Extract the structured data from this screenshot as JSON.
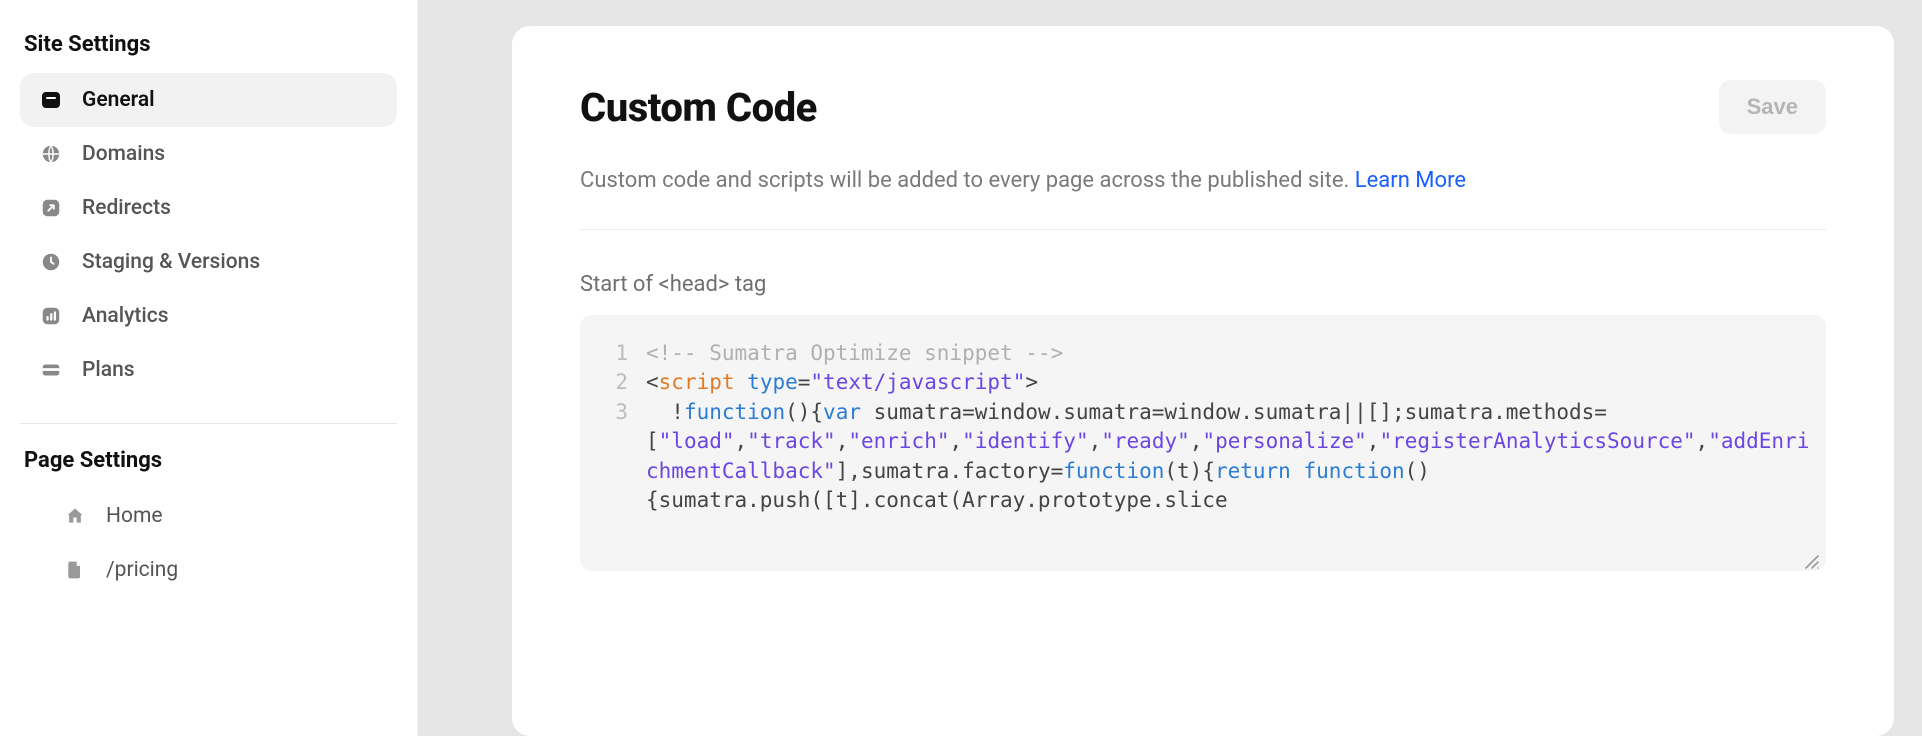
{
  "sidebar": {
    "site_settings_heading": "Site Settings",
    "items": [
      {
        "label": "General",
        "icon": "general"
      },
      {
        "label": "Domains",
        "icon": "globe"
      },
      {
        "label": "Redirects",
        "icon": "redirect"
      },
      {
        "label": "Staging & Versions",
        "icon": "clock"
      },
      {
        "label": "Analytics",
        "icon": "analytics"
      },
      {
        "label": "Plans",
        "icon": "card"
      }
    ],
    "page_settings_heading": "Page Settings",
    "pages": [
      {
        "label": "Home",
        "icon": "home"
      },
      {
        "label": "/pricing",
        "icon": "file"
      }
    ]
  },
  "main": {
    "title": "Custom Code",
    "save_label": "Save",
    "description_text": "Custom code and scripts will be added to every page across the published site. ",
    "learn_more_label": "Learn More",
    "field_label": "Start of <head> tag",
    "code_tokens": [
      [
        {
          "t": "<!-- Sumatra Optimize snippet -->",
          "c": "comment"
        }
      ],
      [
        {
          "t": "<",
          "c": "punct"
        },
        {
          "t": "script",
          "c": "tag"
        },
        {
          "t": " ",
          "c": "punct"
        },
        {
          "t": "type",
          "c": "attr"
        },
        {
          "t": "=",
          "c": "punct"
        },
        {
          "t": "\"text/javascript\"",
          "c": "string"
        },
        {
          "t": ">",
          "c": "punct"
        }
      ],
      [
        {
          "t": "  !",
          "c": "punct"
        },
        {
          "t": "function",
          "c": "keyword"
        },
        {
          "t": "(){",
          "c": "punct"
        },
        {
          "t": "var",
          "c": "keyword"
        },
        {
          "t": " sumatra=window.sumatra=window.sumatra||[];sumatra.methods=[",
          "c": "punct"
        },
        {
          "t": "\"load\"",
          "c": "string"
        },
        {
          "t": ",",
          "c": "punct"
        },
        {
          "t": "\"track\"",
          "c": "string"
        },
        {
          "t": ",",
          "c": "punct"
        },
        {
          "t": "\"enrich\"",
          "c": "string"
        },
        {
          "t": ",",
          "c": "punct"
        },
        {
          "t": "\"identify\"",
          "c": "string"
        },
        {
          "t": ",",
          "c": "punct"
        },
        {
          "t": "\"ready\"",
          "c": "string"
        },
        {
          "t": ",",
          "c": "punct"
        },
        {
          "t": "\"personalize\"",
          "c": "string"
        },
        {
          "t": ",",
          "c": "punct"
        },
        {
          "t": "\"registerAnalyticsSource\"",
          "c": "string"
        },
        {
          "t": ",",
          "c": "punct"
        },
        {
          "t": "\"addEnrichmentCallback\"",
          "c": "string"
        },
        {
          "t": "],sumatra.factory=",
          "c": "punct"
        },
        {
          "t": "function",
          "c": "keyword"
        },
        {
          "t": "(t){",
          "c": "punct"
        },
        {
          "t": "return",
          "c": "keyword"
        },
        {
          "t": " ",
          "c": "punct"
        },
        {
          "t": "function",
          "c": "keyword"
        },
        {
          "t": "(){sumatra.push([t].concat(Array.prototype.slice",
          "c": "punct"
        }
      ]
    ],
    "gutter_numbers": [
      "1",
      "2",
      "3"
    ]
  }
}
